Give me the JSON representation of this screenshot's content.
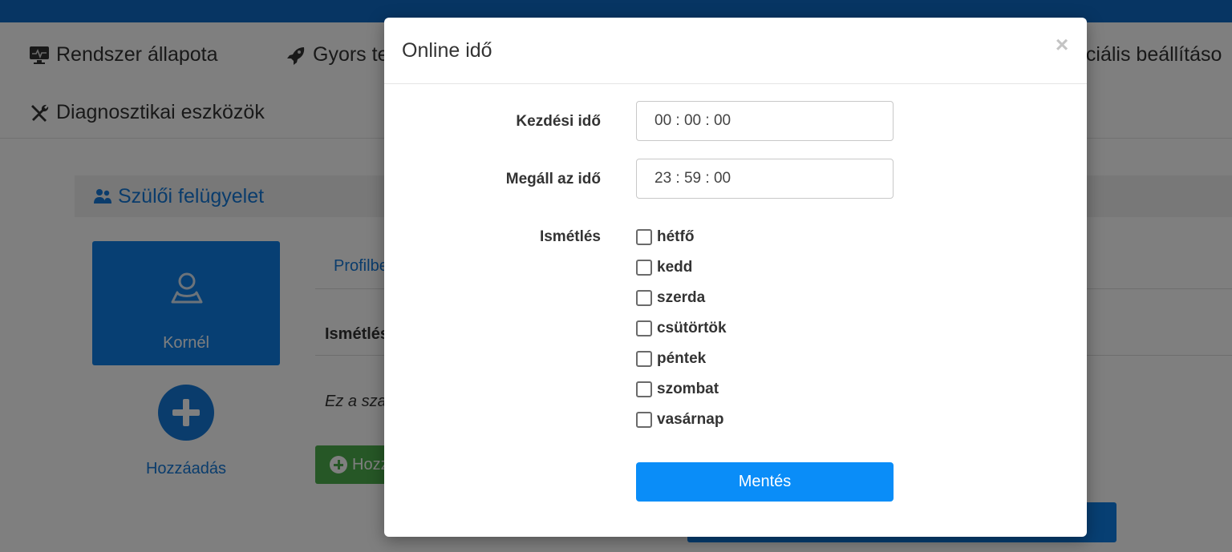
{
  "nav": {
    "items": [
      {
        "label": "Rendszer állapota",
        "icon": "monitor-icon"
      },
      {
        "label": "Gyors te",
        "icon": "rocket-icon"
      },
      {
        "label": "eciális beállításo",
        "icon": ""
      },
      {
        "label": "Diagnosztikai eszközök",
        "icon": "tools-icon"
      }
    ]
  },
  "section": {
    "title": "Szülői felügyelet",
    "icon": "users-icon"
  },
  "profile": {
    "name": "Kornél"
  },
  "add": {
    "label": "Hozzáadás"
  },
  "background": {
    "tab_label": "Profilbe",
    "column_header": "Ismétlés",
    "empty_text": "Ez a sza",
    "green_button_label": "Hozz"
  },
  "modal": {
    "title": "Online idő",
    "close_symbol": "×",
    "start_label": "Kezdési idő",
    "start_value": "00 : 00 : 00",
    "stop_label": "Megáll az idő",
    "stop_value": "23 : 59 : 00",
    "repeat_label": "Ismétlés",
    "days": [
      {
        "label": "hétfő",
        "checked": false
      },
      {
        "label": "kedd",
        "checked": false
      },
      {
        "label": "szerda",
        "checked": false
      },
      {
        "label": "csütörtök",
        "checked": false
      },
      {
        "label": "péntek",
        "checked": false
      },
      {
        "label": "szombat",
        "checked": false
      },
      {
        "label": "vasárnap",
        "checked": false
      }
    ],
    "save_label": "Mentés"
  },
  "colors": {
    "topbar": "#0f6bc7",
    "accent_blue": "#1479d9",
    "save_button": "#0a8df8",
    "green_button": "#4cae4c"
  }
}
